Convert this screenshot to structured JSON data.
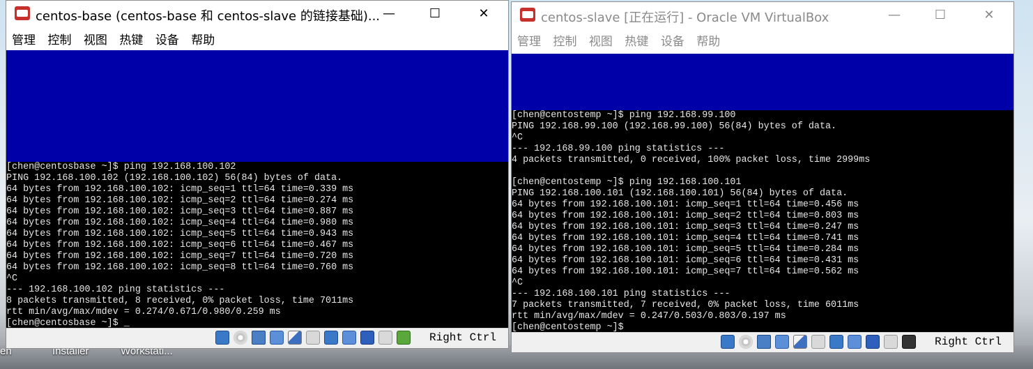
{
  "desktop": {
    "labels": [
      "en",
      "Installer",
      "Workstati..."
    ]
  },
  "windows": [
    {
      "title": "centos-base (centos-base 和 centos-slave 的链接基础)...",
      "controls": {
        "minimize": "—",
        "maximize": "☐",
        "close": "✕"
      },
      "menu": [
        "管理",
        "控制",
        "视图",
        "热键",
        "设备",
        "帮助"
      ],
      "terminal_lines": [
        "[chen@centosbase ~]$ ping 192.168.100.102",
        "PING 192.168.100.102 (192.168.100.102) 56(84) bytes of data.",
        "64 bytes from 192.168.100.102: icmp_seq=1 ttl=64 time=0.339 ms",
        "64 bytes from 192.168.100.102: icmp_seq=2 ttl=64 time=0.274 ms",
        "64 bytes from 192.168.100.102: icmp_seq=3 ttl=64 time=0.887 ms",
        "64 bytes from 192.168.100.102: icmp_seq=4 ttl=64 time=0.980 ms",
        "64 bytes from 192.168.100.102: icmp_seq=5 ttl=64 time=0.943 ms",
        "64 bytes from 192.168.100.102: icmp_seq=6 ttl=64 time=0.467 ms",
        "64 bytes from 192.168.100.102: icmp_seq=7 ttl=64 time=0.720 ms",
        "64 bytes from 192.168.100.102: icmp_seq=8 ttl=64 time=0.760 ms",
        "^C",
        "--- 192.168.100.102 ping statistics ---",
        "8 packets transmitted, 8 received, 0% packet loss, time 7011ms",
        "rtt min/avg/max/mdev = 0.274/0.671/0.980/0.259 ms",
        "[chen@centosbase ~]$ _"
      ],
      "host_key": "Right Ctrl"
    },
    {
      "title": "centos-slave [正在运行] - Oracle VM VirtualBox",
      "controls": {
        "minimize": "—",
        "maximize": "☐",
        "close": "✕"
      },
      "menu": [
        "管理",
        "控制",
        "视图",
        "热键",
        "设备",
        "帮助"
      ],
      "terminal_lines": [
        "[chen@centostemp ~]$ ping 192.168.99.100",
        "PING 192.168.99.100 (192.168.99.100) 56(84) bytes of data.",
        "^C",
        "--- 192.168.99.100 ping statistics ---",
        "4 packets transmitted, 0 received, 100% packet loss, time 2999ms",
        "",
        "[chen@centostemp ~]$ ping 192.168.100.101",
        "PING 192.168.100.101 (192.168.100.101) 56(84) bytes of data.",
        "64 bytes from 192.168.100.101: icmp_seq=1 ttl=64 time=0.456 ms",
        "64 bytes from 192.168.100.101: icmp_seq=2 ttl=64 time=0.803 ms",
        "64 bytes from 192.168.100.101: icmp_seq=3 ttl=64 time=0.247 ms",
        "64 bytes from 192.168.100.101: icmp_seq=4 ttl=64 time=0.741 ms",
        "64 bytes from 192.168.100.101: icmp_seq=5 ttl=64 time=0.284 ms",
        "64 bytes from 192.168.100.101: icmp_seq=6 ttl=64 time=0.431 ms",
        "64 bytes from 192.168.100.101: icmp_seq=7 ttl=64 time=0.562 ms",
        "^C",
        "--- 192.168.100.101 ping statistics ---",
        "7 packets transmitted, 7 received, 0% packet loss, time 6011ms",
        "rtt min/avg/max/mdev = 0.247/0.503/0.803/0.197 ms",
        "[chen@centostemp ~]$"
      ],
      "host_key": "Right Ctrl"
    }
  ],
  "colors": {
    "guest_blue": "#0000a8",
    "terminal_bg": "#000000",
    "terminal_fg": "#e6e6e6"
  },
  "icons": {
    "statusbar": [
      "hard-disk-icon",
      "optical-disk-icon",
      "usb-icon",
      "network-icon",
      "shared-folder-icon",
      "display-icon",
      "video-capture-icon",
      "vm-icon",
      "mouse-integration-icon",
      "keyboard-icon"
    ]
  }
}
